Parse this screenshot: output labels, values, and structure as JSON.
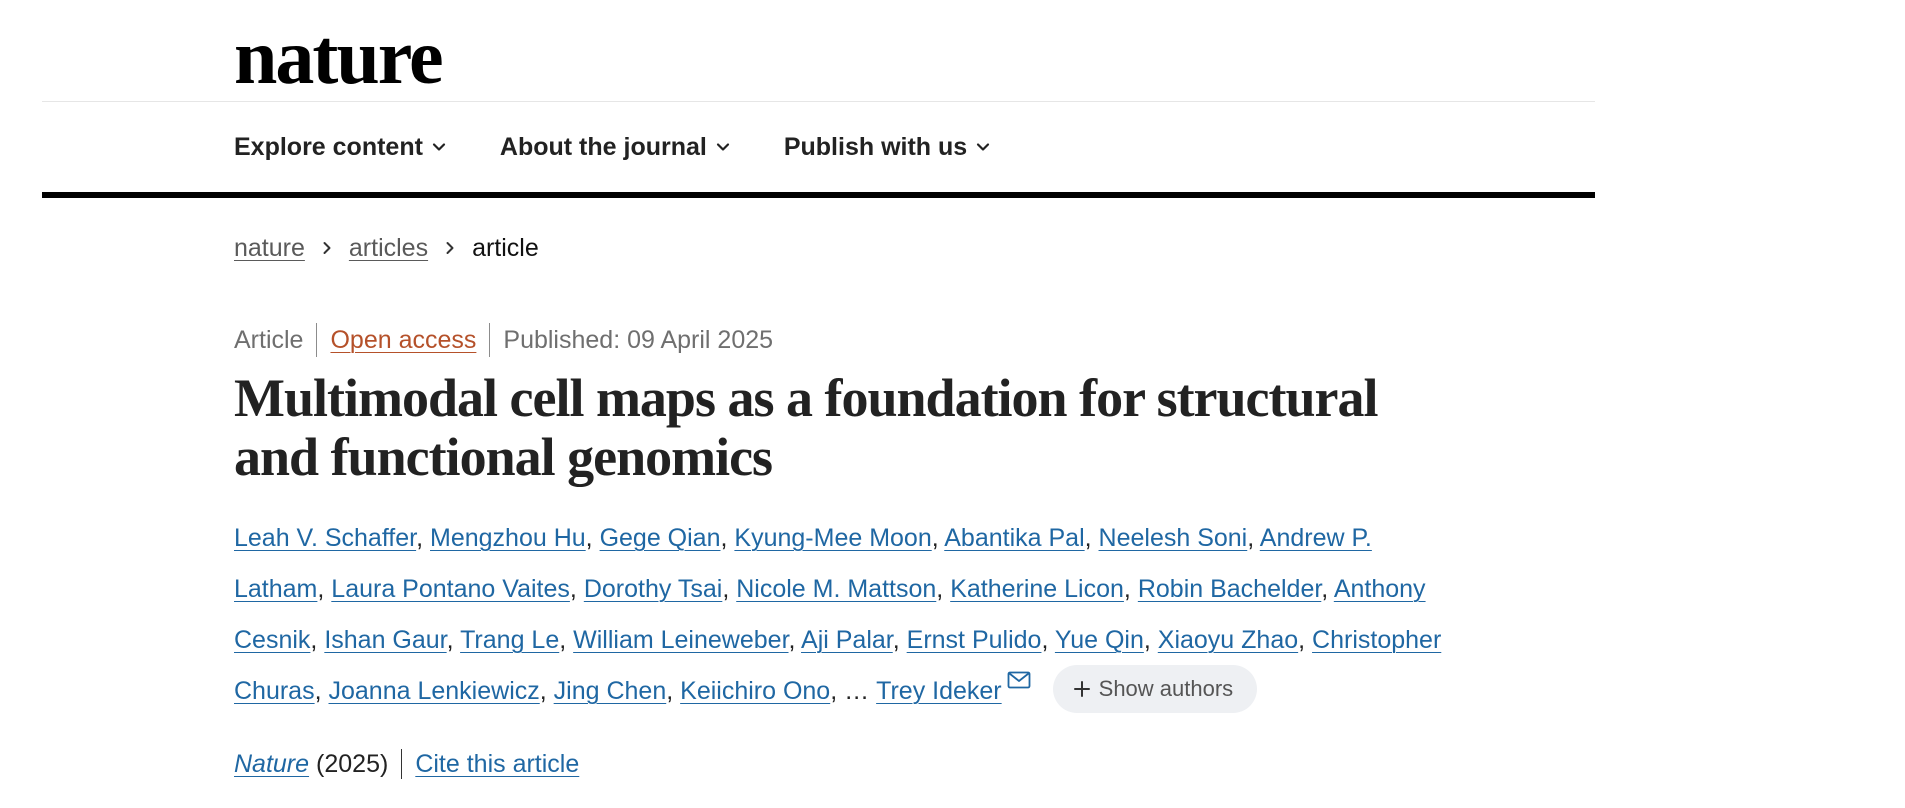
{
  "header": {
    "logo": "nature",
    "nav": [
      {
        "label": "Explore content",
        "icon": "chevron-down-icon"
      },
      {
        "label": "About the journal",
        "icon": "chevron-down-icon"
      },
      {
        "label": "Publish with us",
        "icon": "chevron-down-icon"
      }
    ]
  },
  "breadcrumb": {
    "items": [
      {
        "label": "nature",
        "current": false
      },
      {
        "label": "articles",
        "current": false
      },
      {
        "label": "article",
        "current": true
      }
    ],
    "separator_icon": "chevron-right-icon"
  },
  "article": {
    "type": "Article",
    "access": "Open access",
    "published": "Published: 09 April 2025",
    "title": "Multimodal cell maps as a foundation for structural and functional genomics",
    "authors": [
      "Leah V. Schaffer",
      "Mengzhou Hu",
      "Gege Qian",
      "Kyung-Mee Moon",
      "Abantika Pal",
      "Neelesh Soni",
      "Andrew P. Latham",
      "Laura Pontano Vaites",
      "Dorothy Tsai",
      "Nicole M. Mattson",
      "Katherine Licon",
      "Robin Bachelder",
      "Anthony Cesnik",
      "Ishan Gaur",
      "Trang Le",
      "William Leineweber",
      "Aji Palar",
      "Ernst Pulido",
      "Yue Qin",
      "Xiaoyu Zhao",
      "Christopher Churas",
      "Joanna Lenkiewicz",
      "Jing Chen",
      "Keiichiro Ono"
    ],
    "author_separator": ", ",
    "authors_ellipsis": "…",
    "corresponding_author": "Trey Ideker",
    "corresponding_icon": "mail-icon",
    "show_authors": {
      "label": "Show authors",
      "icon": "plus-icon"
    },
    "citation": {
      "journal": "Nature",
      "year": "(2025)",
      "cite_label": "Cite this article"
    }
  },
  "colors": {
    "text": "#222222",
    "muted": "#6f6f6f",
    "link": "#1f67a3",
    "open_access": "#b5512a",
    "rule": "#000000",
    "button_bg": "#eef0f3"
  }
}
